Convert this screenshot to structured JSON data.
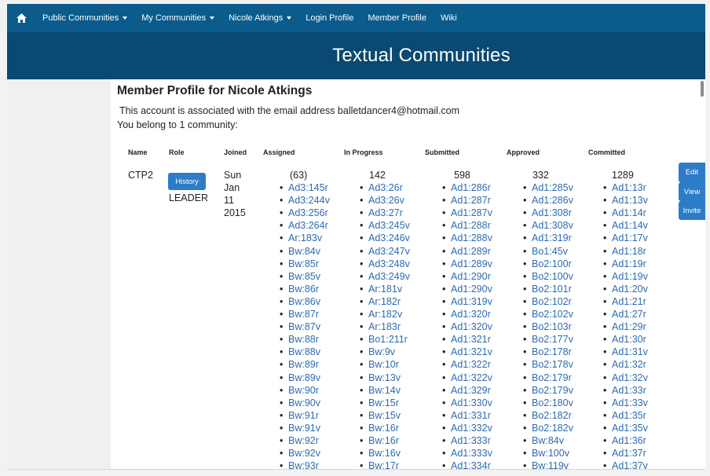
{
  "nav": {
    "home_icon": "home-icon",
    "items": [
      {
        "label": "Public Communities",
        "has_caret": true
      },
      {
        "label": "My Communities",
        "has_caret": true
      },
      {
        "label": "Nicole Atkings",
        "has_caret": true
      },
      {
        "label": "Login Profile",
        "has_caret": false
      },
      {
        "label": "Member Profile",
        "has_caret": false
      },
      {
        "label": "Wiki",
        "has_caret": false
      }
    ]
  },
  "banner": {
    "title": "Textual Communities"
  },
  "profile": {
    "title": "Member Profile for Nicole Atkings",
    "email_line": "This account is associated with the email address balletdancer4@hotmail.com",
    "community_line": "You belong to 1 community:"
  },
  "table": {
    "headers": {
      "name": "Name",
      "role": "Role",
      "joined": "Joined",
      "assigned": "Assigned",
      "in_progress": "In Progress",
      "submitted": "Submitted",
      "approved": "Approved",
      "committed": "Committed"
    },
    "row": {
      "name": "CTP2",
      "history_label": "History",
      "role": "LEADER",
      "joined": [
        "Sun",
        "Jan",
        "11",
        "2015"
      ],
      "assigned": {
        "count": "(63)",
        "items": [
          "Ad3:145r",
          "Ad3:244v",
          "Ad3:256r",
          "Ad3:264r",
          "Ar:183v",
          "Bw:84v",
          "Bw:85r",
          "Bw:85v",
          "Bw:86r",
          "Bw:86v",
          "Bw:87r",
          "Bw:87v",
          "Bw:88r",
          "Bw:88v",
          "Bw:89r",
          "Bw:89v",
          "Bw:90r",
          "Bw:90v",
          "Bw:91r",
          "Bw:91v",
          "Bw:92r",
          "Bw:92v",
          "Bw:93r"
        ]
      },
      "in_progress": {
        "count": "142",
        "items": [
          "Ad3:26r",
          "Ad3:26v",
          "Ad3:27r",
          "Ad3:245v",
          "Ad3:246v",
          "Ad3:247v",
          "Ad3:248v",
          "Ad3:249v",
          "Ar:181v",
          "Ar:182r",
          "Ar:182v",
          "Ar:183r",
          "Bo1:211r",
          "Bw:9v",
          "Bw:10r",
          "Bw:13v",
          "Bw:14v",
          "Bw:15r",
          "Bw:15v",
          "Bw:16r",
          "Bw:16r",
          "Bw:16v",
          "Bw:17r"
        ]
      },
      "submitted": {
        "count": "598",
        "items": [
          "Ad1:286r",
          "Ad1:287r",
          "Ad1:287v",
          "Ad1:288r",
          "Ad1:288v",
          "Ad1:289r",
          "Ad1:289v",
          "Ad1:290r",
          "Ad1:290v",
          "Ad1:319v",
          "Ad1:320r",
          "Ad1:320v",
          "Ad1:321r",
          "Ad1:321v",
          "Ad1:322r",
          "Ad1:322v",
          "Ad1:329r",
          "Ad1:330v",
          "Ad1:331r",
          "Ad1:332v",
          "Ad1:333r",
          "Ad1:333v",
          "Ad1:334r"
        ]
      },
      "approved": {
        "count": "332",
        "items": [
          "Ad1:285v",
          "Ad1:286v",
          "Ad1:308r",
          "Ad1:308v",
          "Ad1:319r",
          "Bo1:45v",
          "Bo2:100r",
          "Bo2:100v",
          "Bo2:101r",
          "Bo2:102r",
          "Bo2:102v",
          "Bo2:103r",
          "Bo2:177v",
          "Bo2:178r",
          "Bo2:178v",
          "Bo2:179r",
          "Bo2:179v",
          "Bo2:180v",
          "Bo2:182r",
          "Bo2:182v",
          "Bw:84v",
          "Bw:100v",
          "Bw:119v"
        ]
      },
      "committed": {
        "count": "1289",
        "items": [
          "Ad1:13r",
          "Ad1:13v",
          "Ad1:14r",
          "Ad1:14v",
          "Ad1:17v",
          "Ad1:18r",
          "Ad1:19r",
          "Ad1:19v",
          "Ad1:20v",
          "Ad1:21r",
          "Ad1:27r",
          "Ad1:29r",
          "Ad1:30r",
          "Ad1:31v",
          "Ad1:32r",
          "Ad1:32v",
          "Ad1:33r",
          "Ad1:33v",
          "Ad1:35r",
          "Ad1:35v",
          "Ad1:36r",
          "Ad1:37r",
          "Ad1:37v"
        ]
      }
    }
  },
  "actions": {
    "edit": "Edit",
    "view": "View",
    "invite": "Invite"
  },
  "colors": {
    "nav_bg": "#0b5b8c",
    "banner_bg": "#0a4971",
    "button_bg": "#2d7cc9",
    "link": "#2d6bb0"
  }
}
